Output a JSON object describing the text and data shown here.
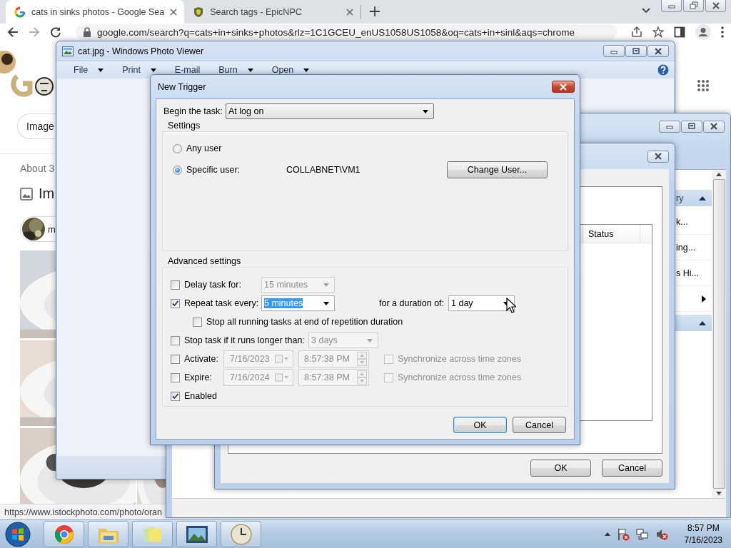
{
  "browser": {
    "tabs": [
      {
        "title": "cats in sinks photos - Google Sea",
        "selected": true
      },
      {
        "title": "Search tags - EpicNPC",
        "selected": false
      }
    ],
    "url": "google.com/search?q=cats+in+sinks+photos&rlz=1C1GCEU_enUS1058US1058&oq=cats+in+sinl&aqs=chrome",
    "page": {
      "chip": "Image",
      "result_count": "About 3",
      "section_title": "Im",
      "source": "m"
    },
    "status_url": "https://www.istockphoto.com/photo/oran"
  },
  "task_scheduler": {
    "actions": [
      {
        "kind": "header",
        "label": "ry"
      },
      {
        "kind": "item",
        "label": "k..."
      },
      {
        "kind": "item",
        "label": "ing..."
      },
      {
        "kind": "item",
        "label": "s Hi..."
      },
      {
        "kind": "submenu"
      },
      {
        "kind": "header"
      }
    ]
  },
  "trigger_properties": {
    "column": "Status",
    "buttons": [
      {
        "label": "OK"
      },
      {
        "label": "Cancel"
      }
    ]
  },
  "photo_viewer": {
    "title": "cat.jpg - Windows Photo Viewer",
    "menu": [
      {
        "label": "File",
        "dropdown": true
      },
      {
        "label": "Print",
        "dropdown": true
      },
      {
        "label": "E-mail",
        "dropdown": false
      },
      {
        "label": "Burn",
        "dropdown": true
      },
      {
        "label": "Open",
        "dropdown": true
      }
    ]
  },
  "new_trigger": {
    "title": "New Trigger",
    "begin_label": "Begin the task:",
    "begin_value": "At log on",
    "settings_title": "Settings",
    "users": [
      {
        "label": "Any user",
        "selected": false
      },
      {
        "label": "Specific user:",
        "selected": true,
        "account": "COLLABNET\\VM1"
      }
    ],
    "change_user": "Change User...",
    "advanced_title": "Advanced settings",
    "delay": {
      "label": "Delay task for:",
      "checked": false,
      "value": "15 minutes",
      "disabled": true
    },
    "repeat": {
      "label": "Repeat task every:",
      "checked": true,
      "value": "5 minutes",
      "disabled": false,
      "value_highlighted": true,
      "duration_label": "for a duration of:",
      "duration": "1 day"
    },
    "stop_all": {
      "label": "Stop all running tasks at end of repetition duration",
      "checked": false
    },
    "stop_long": {
      "label": "Stop task if it runs longer than:",
      "checked": false,
      "value": "3 days",
      "disabled": true
    },
    "activate": {
      "label": "Activate:",
      "checked": false,
      "date": "7/16/2023",
      "time": "8:57:38 PM",
      "disabled": true,
      "sync": {
        "label": "Synchronize across time zones",
        "checked": false,
        "disabled": true
      }
    },
    "expire": {
      "label": "Expire:",
      "checked": false,
      "date": "7/16/2024",
      "time": "8:57:38 PM",
      "disabled": true,
      "sync": {
        "label": "Synchronize across time zones",
        "checked": false,
        "disabled": true
      }
    },
    "enabled": {
      "label": "Enabled",
      "checked": true
    },
    "buttons": [
      {
        "label": "OK",
        "default": true
      },
      {
        "label": "Cancel",
        "default": false
      }
    ]
  },
  "taskbar": {
    "time": "8:57 PM",
    "date": "7/16/2023"
  }
}
